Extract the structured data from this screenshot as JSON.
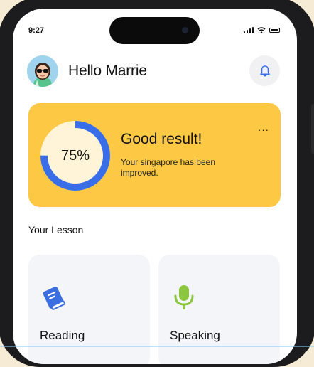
{
  "status_bar": {
    "time": "9:27"
  },
  "header": {
    "greeting": "Hello Marrie"
  },
  "result_card": {
    "progress_label": "75%",
    "progress_value": 0.75,
    "title": "Good result!",
    "description": "Your singapore has been improved.",
    "more_label": "···"
  },
  "lessons": {
    "section_title": "Your Lesson",
    "items": [
      {
        "label": "Reading",
        "icon": "book-icon"
      },
      {
        "label": "Speaking",
        "icon": "microphone-icon"
      }
    ]
  },
  "colors": {
    "card_yellow": "#fdc843",
    "progress_blue": "#3a6ee8",
    "ring_track": "#fff4d8",
    "book_blue": "#3b6fe0",
    "mic_green": "#8cc63f",
    "lesson_bg": "#f3f5f9"
  }
}
